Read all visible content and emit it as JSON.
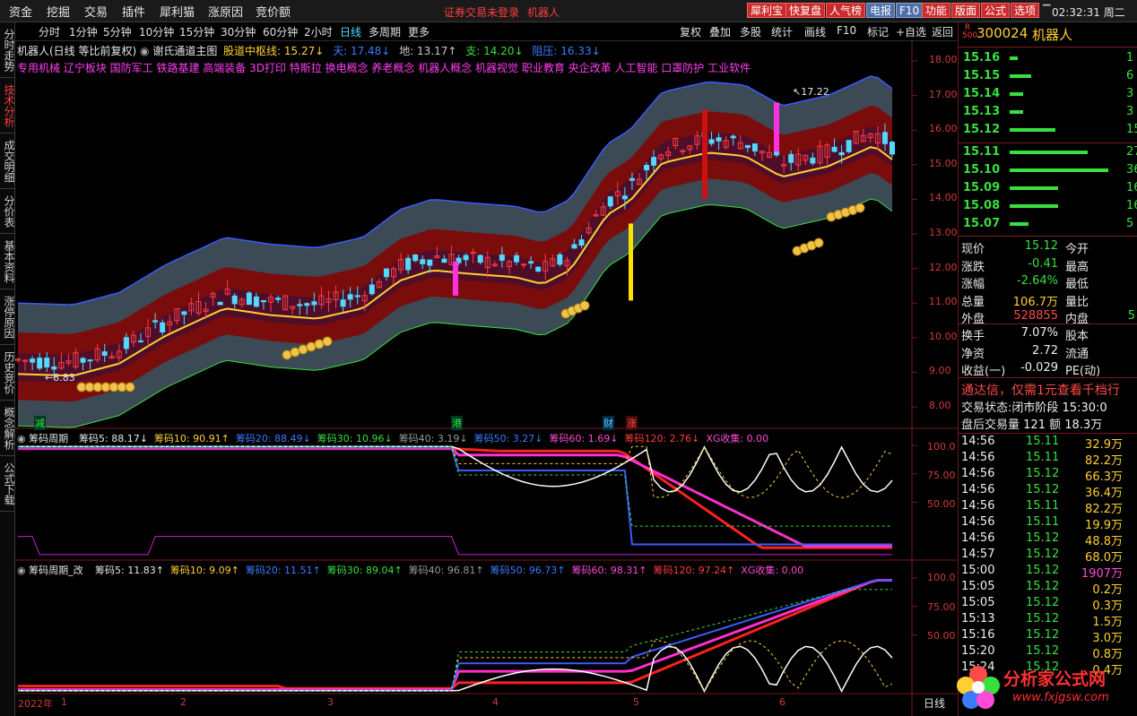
{
  "topmenu": {
    "items": [
      "资金",
      "挖掘",
      "交易",
      "插件",
      "犀利猫",
      "涨原因",
      "竞价额"
    ],
    "notice": "证券交易未登录",
    "notice_stock": "机器人",
    "buttons": [
      "犀利宝",
      "快复盘",
      "人气榜",
      "电报",
      "F10",
      "功能",
      "版面",
      "公式",
      "选项"
    ],
    "clock": "02:32:31 周二"
  },
  "lefttabs": [
    "分时走势",
    "技术分析",
    "成交明细",
    "分价表",
    "基本资料",
    "涨停原因",
    "历史竞价",
    "概念解析",
    "公式下载"
  ],
  "periodbar": {
    "periods": [
      "分时",
      "1分钟",
      "5分钟",
      "10分钟",
      "15分钟",
      "30分钟",
      "60分钟",
      "2小时",
      "日线",
      "多周期",
      "更多"
    ],
    "active": "日线",
    "controls": [
      "复权",
      "叠加",
      "多股",
      "统计",
      "画线",
      "F10",
      "标记",
      "+自选",
      "返回"
    ]
  },
  "chart": {
    "title": "机器人(日线 等比前复权)",
    "indicator": "谢氏通道主图",
    "values": [
      {
        "label": "股道中枢线:",
        "value": "15.27",
        "arrow": "↓",
        "color": "#ffd030"
      },
      {
        "label": "天:",
        "value": "17.48",
        "arrow": "↓",
        "color": "#3b7bff"
      },
      {
        "label": "地:",
        "value": "13.17",
        "arrow": "↑",
        "color": "#c8c8c8"
      },
      {
        "label": "支:",
        "value": "14.20",
        "arrow": "↓",
        "color": "#38e03e"
      },
      {
        "label": "阻压:",
        "value": "16.33",
        "arrow": "↓",
        "color": "#3b7bff"
      }
    ],
    "concepts": "专用机械 辽宁板块 国防军工 铁路基建 高端装备 3D打印 特斯拉 换电概念 养老概念 机器人概念 机器视觉 职业教育 央企改革 人工智能 口罩防护 工业软件",
    "yaxis": [
      "18.00",
      "17.00",
      "16.00",
      "15.00",
      "14.00",
      "13.00",
      "12.00",
      "11.00",
      "10.00",
      "9.00",
      "8.00"
    ],
    "high_label": "17.22",
    "low_label": "8.83",
    "markers": [
      {
        "text": "减",
        "color": "#38e03e",
        "bg": "#004a2a"
      },
      {
        "text": "港",
        "color": "#38e03e",
        "bg": "#004a2a"
      },
      {
        "text": "财",
        "color": "#52d9ff",
        "bg": "#0a2a4a"
      },
      {
        "text": "涨",
        "color": "#ff4a4a",
        "bg": "#4a0a0a"
      }
    ]
  },
  "ind1": {
    "name": "筹码周期",
    "values": [
      {
        "label": "筹码5:",
        "value": "88.17",
        "arrow": "↓",
        "color": "#e6e6e6"
      },
      {
        "label": "筹码10:",
        "value": "90.91",
        "arrow": "↑",
        "color": "#ffd030"
      },
      {
        "label": "筹码20:",
        "value": "88.49",
        "arrow": "↓",
        "color": "#3b7bff"
      },
      {
        "label": "筹码30:",
        "value": "10.96",
        "arrow": "↓",
        "color": "#38e03e"
      },
      {
        "label": "筹码40:",
        "value": "3.19",
        "arrow": "↓",
        "color": "#9a9a9a"
      },
      {
        "label": "筹码50:",
        "value": "3.27",
        "arrow": "↓",
        "color": "#3b7bff"
      },
      {
        "label": "筹码60:",
        "value": "1.69",
        "arrow": "↓",
        "color": "#ff4ad8"
      },
      {
        "label": "筹码120:",
        "value": "2.76",
        "arrow": "↓",
        "color": "#ff3d3d"
      },
      {
        "label": "XG收集:",
        "value": "0.00",
        "arrow": "",
        "color": "#ff4ad8"
      }
    ],
    "yaxis": [
      "100.0",
      "75.00",
      "50.00"
    ]
  },
  "ind2": {
    "name": "筹码周期_改",
    "values": [
      {
        "label": "筹码5:",
        "value": "11.83",
        "arrow": "↑",
        "color": "#e6e6e6"
      },
      {
        "label": "筹码10:",
        "value": "9.09",
        "arrow": "↑",
        "color": "#ffd030"
      },
      {
        "label": "筹码20:",
        "value": "11.51",
        "arrow": "↑",
        "color": "#3b7bff"
      },
      {
        "label": "筹码30:",
        "value": "89.04",
        "arrow": "↑",
        "color": "#38e03e"
      },
      {
        "label": "筹码40:",
        "value": "96.81",
        "arrow": "↑",
        "color": "#9a9a9a"
      },
      {
        "label": "筹码50:",
        "value": "96.73",
        "arrow": "↑",
        "color": "#3b7bff"
      },
      {
        "label": "筹码60:",
        "value": "98.31",
        "arrow": "↑",
        "color": "#ff4ad8"
      },
      {
        "label": "筹码120:",
        "value": "97.24",
        "arrow": "↑",
        "color": "#ff3d3d"
      },
      {
        "label": "XG收集:",
        "value": "0.00",
        "arrow": "",
        "color": "#ff4ad8"
      }
    ],
    "yaxis": [
      "100.0",
      "75.00",
      "50.00"
    ]
  },
  "xaxis": {
    "year": "2022年",
    "months": [
      "1",
      "2",
      "3",
      "4",
      "5",
      "6"
    ],
    "period": "日线"
  },
  "quote": {
    "code_prefix": "R",
    "code_sub": "500",
    "code": "300024",
    "name": "机器人",
    "asks": [
      {
        "price": "15.16",
        "vol": "1"
      },
      {
        "price": "15.15",
        "vol": "6"
      },
      {
        "price": "15.14",
        "vol": "3"
      },
      {
        "price": "15.13",
        "vol": "3"
      },
      {
        "price": "15.12",
        "vol": "15"
      }
    ],
    "bids": [
      {
        "price": "15.11",
        "vol": "27"
      },
      {
        "price": "15.10",
        "vol": "36"
      },
      {
        "price": "15.09",
        "vol": "16"
      },
      {
        "price": "15.08",
        "vol": "16"
      },
      {
        "price": "15.07",
        "vol": "5"
      }
    ],
    "stats": [
      {
        "l1": "现价",
        "v1": "15.12",
        "c1": "grn",
        "l2": "今开",
        "v2": "",
        "c2": "grn"
      },
      {
        "l1": "涨跌",
        "v1": "-0.41",
        "c1": "grn",
        "l2": "最高",
        "v2": "",
        "c2": "red"
      },
      {
        "l1": "涨幅",
        "v1": "-2.64%",
        "c1": "grn",
        "l2": "最低",
        "v2": "",
        "c2": "grn"
      },
      {
        "l1": "总量",
        "v1": "106.7万",
        "c1": "yel",
        "l2": "量比",
        "v2": "",
        "c2": "wht"
      },
      {
        "l1": "外盘",
        "v1": "528855",
        "c1": "red",
        "l2": "内盘",
        "v2": "5",
        "c2": "grn"
      }
    ],
    "stats2": [
      {
        "l1": "换手",
        "v1": "7.07%",
        "c1": "wht",
        "l2": "股本",
        "v2": "",
        "c2": "wht"
      },
      {
        "l1": "净资",
        "v1": "2.72",
        "c1": "wht",
        "l2": "流通",
        "v2": "",
        "c2": "wht"
      },
      {
        "l1": "收益(一)",
        "v1": "-0.029",
        "c1": "wht",
        "l2": "PE(动)",
        "v2": "",
        "c2": "wht"
      }
    ],
    "promo": "通达信，仅需1元查看千档行",
    "state_label": "交易状态:",
    "state_value": "闭市阶段 15:30:0",
    "after_label": "盘后交易量",
    "after_vol": "121",
    "after_amt_label": "额",
    "after_amt": "18.3万"
  },
  "ticks": [
    {
      "time": "14:56",
      "price": "15.11",
      "vol": "32.9万"
    },
    {
      "time": "14:56",
      "price": "15.11",
      "vol": "82.2万"
    },
    {
      "time": "14:56",
      "price": "15.12",
      "vol": "66.3万"
    },
    {
      "time": "14:56",
      "price": "15.12",
      "vol": "36.4万"
    },
    {
      "time": "14:56",
      "price": "15.11",
      "vol": "82.2万"
    },
    {
      "time": "14:56",
      "price": "15.11",
      "vol": "19.9万"
    },
    {
      "time": "14:56",
      "price": "15.12",
      "vol": "48.8万"
    },
    {
      "time": "14:57",
      "price": "15.12",
      "vol": "68.0万"
    },
    {
      "time": "15:00",
      "price": "15.12",
      "vol": "1907万"
    },
    {
      "time": "15:05",
      "price": "15.12",
      "vol": "0.2万"
    },
    {
      "time": "15:05",
      "price": "15.12",
      "vol": "0.3万"
    },
    {
      "time": "15:13",
      "price": "15.12",
      "vol": "1.5万"
    },
    {
      "time": "15:16",
      "price": "15.12",
      "vol": "3.0万"
    },
    {
      "time": "15:20",
      "price": "15.12",
      "vol": "0.8万"
    },
    {
      "time": "15:24",
      "price": "15.12",
      "vol": "0.4万"
    }
  ],
  "watermark": {
    "name": "分析家公式网",
    "url": "www.fxjgsw.com"
  },
  "colors": {
    "up": "#ff3d3d",
    "down": "#52d9ff",
    "ma": "#ffd030",
    "band_outer": "#3b4a55",
    "band_inner": "#7a0c0c",
    "border": "#7a1a1a"
  }
}
